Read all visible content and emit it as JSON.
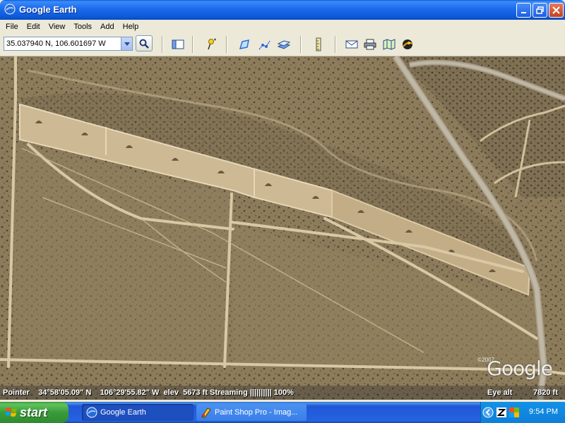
{
  "window": {
    "title": "Google Earth"
  },
  "menu": [
    "File",
    "Edit",
    "View",
    "Tools",
    "Add",
    "Help"
  ],
  "toolbar": {
    "coordinates": "35.037940 N, 106.601697 W",
    "icons": [
      "sidebar-icon",
      "placemark-icon",
      "polygon-icon",
      "path-icon",
      "image-overlay-icon",
      "ruler-icon",
      "email-icon",
      "print-icon",
      "map-icon",
      "sky-icon"
    ]
  },
  "map": {
    "copyright": "©2007",
    "watermark": "Google"
  },
  "status": {
    "pointer_label": "Pointer",
    "lat": "34°58'05.09\" N",
    "lon": "106°29'55.82\" W",
    "elev_label": "elev",
    "elev": "5673 ft",
    "streaming_label": "Streaming",
    "streaming_bars": "||||||||||",
    "streaming_pct": "100%",
    "eye_label": "Eye alt",
    "eye_alt": "7820 ft"
  },
  "taskbar": {
    "start_label": "start",
    "tasks": [
      {
        "label": "Google Earth",
        "active": true
      },
      {
        "label": "Paint Shop Pro - Imag...",
        "active": false
      }
    ],
    "clock": "9:54 PM"
  }
}
